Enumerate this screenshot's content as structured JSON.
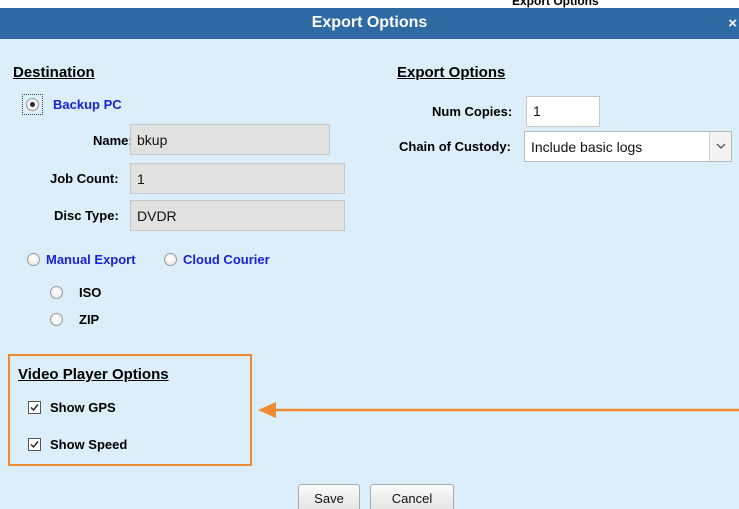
{
  "partial_header": {
    "text": "Export Options"
  },
  "dialog": {
    "title": "Export Options",
    "close": "×"
  },
  "destination": {
    "heading": "Destination",
    "backup_pc": {
      "label": "Backup PC",
      "selected": true
    },
    "name": {
      "label": "Name:",
      "value": "bkup"
    },
    "job_count": {
      "label": "Job Count:",
      "value": "1"
    },
    "disc_type": {
      "label": "Disc Type:",
      "value": "DVDR"
    },
    "manual_export": {
      "label": "Manual Export",
      "selected": false
    },
    "cloud_courier": {
      "label": "Cloud Courier",
      "selected": false
    },
    "iso": {
      "label": "ISO",
      "selected": false
    },
    "zip": {
      "label": "ZIP",
      "selected": false
    }
  },
  "export_options": {
    "heading": "Export Options",
    "num_copies": {
      "label": "Num Copies:",
      "value": "1"
    },
    "chain_of_custody": {
      "label": "Chain of Custody:",
      "value": "Include basic logs"
    }
  },
  "video_player_options": {
    "heading": "Video Player Options",
    "show_gps": {
      "label": "Show GPS",
      "checked": true
    },
    "show_speed": {
      "label": "Show Speed",
      "checked": true
    }
  },
  "buttons": {
    "save": "Save",
    "cancel": "Cancel"
  },
  "colors": {
    "title_bar": "#2f6aa4",
    "background": "#dbeef9",
    "link": "#1a23d6",
    "highlight": "#ee8a2f"
  },
  "icons": {
    "close": "close-icon",
    "dropdown": "chevron-down-icon",
    "arrow": "arrow-left-icon",
    "checkbox": "checkmark-icon"
  }
}
